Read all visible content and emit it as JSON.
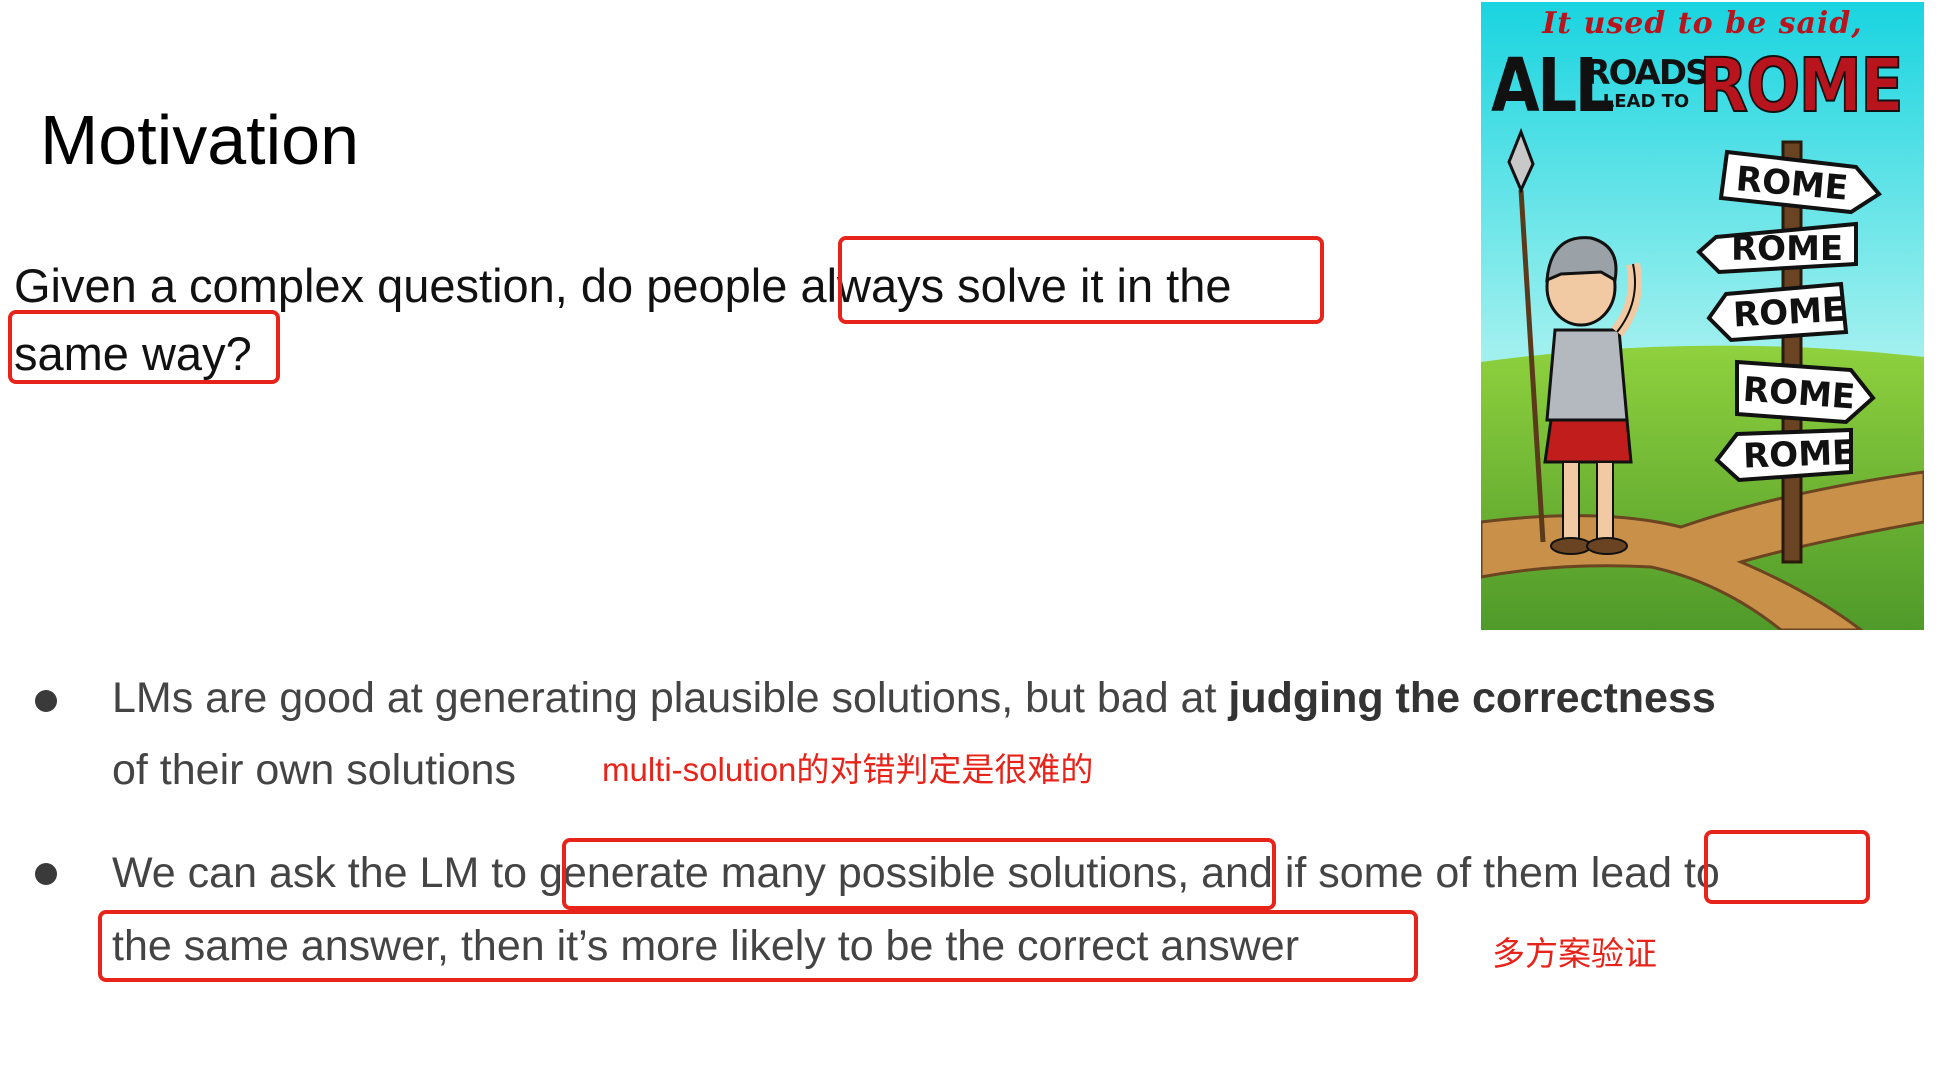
{
  "slide": {
    "title": "Motivation",
    "question_line1": "Given a complex question, do people always solve it in the",
    "question_line2": "same way?"
  },
  "bullets": [
    {
      "line1_regular": "LMs are good at generating plausible solutions, but bad at ",
      "line1_bold": "judging the correctness",
      "line2": "of their own solutions"
    },
    {
      "line1": "We can ask the LM to generate many possible solutions, and if some of them lead to",
      "line2": "the same answer, then it’s more likely to be the correct answer"
    }
  ],
  "annotations": {
    "note_bullet1": "multi-solution的对错判定是很难的",
    "note_bullet2": "多方案验证",
    "color": "#e8231a"
  },
  "poster": {
    "caption": "It used to be said,",
    "word_all": "ALL",
    "word_roads": "ROADS",
    "word_lead_to": "LEAD TO",
    "word_rome": "ROME",
    "signs": [
      "ROME",
      "ROME",
      "ROME",
      "ROME",
      "ROME"
    ]
  }
}
